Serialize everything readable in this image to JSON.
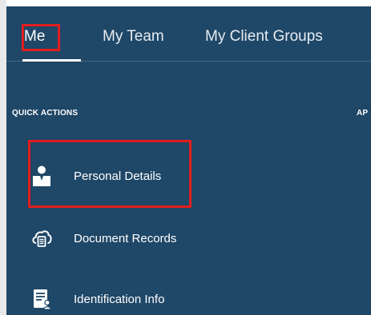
{
  "tabs": [
    {
      "label": "Me",
      "active": true
    },
    {
      "label": "My Team",
      "active": false
    },
    {
      "label": "My Client Groups",
      "active": false
    }
  ],
  "sections": {
    "quick_actions_title": "QUICK ACTIONS",
    "apps_title_partial": "AP"
  },
  "quick_actions": [
    {
      "label": "Personal Details",
      "icon": "person-icon"
    },
    {
      "label": "Document Records",
      "icon": "cloud-document-icon"
    },
    {
      "label": "Identification Info",
      "icon": "id-card-icon"
    }
  ],
  "colors": {
    "panel_bg": "#1f4767",
    "highlight": "#e21d1d",
    "text": "#ffffff"
  }
}
